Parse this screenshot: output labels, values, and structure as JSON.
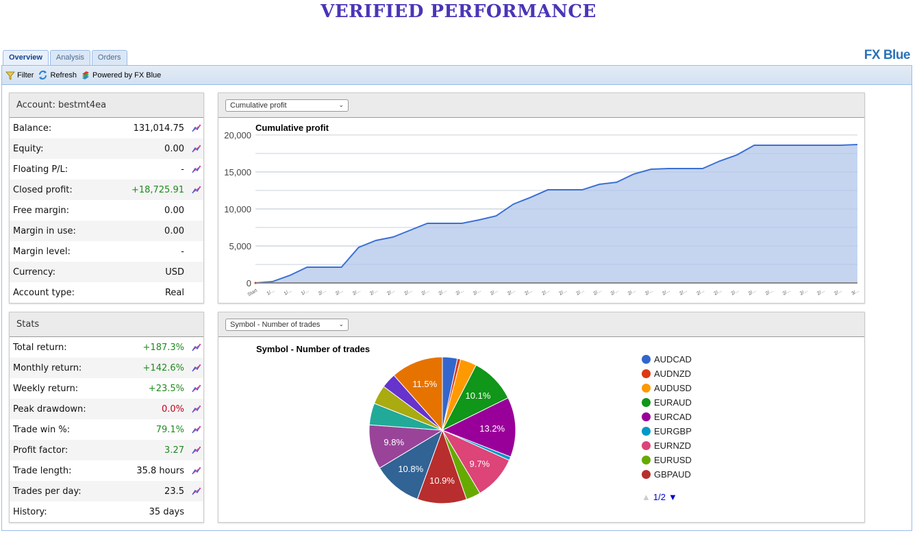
{
  "page_title": "VERIFIED PERFORMANCE",
  "brand": "FX Blue",
  "tabs": [
    {
      "label": "Overview",
      "active": true
    },
    {
      "label": "Analysis",
      "active": false
    },
    {
      "label": "Orders",
      "active": false
    }
  ],
  "toolbar": {
    "filter": "Filter",
    "refresh": "Refresh",
    "powered": "Powered by FX Blue"
  },
  "account": {
    "title": "Account: bestmt4ea",
    "rows": [
      {
        "label": "Balance:",
        "value": "131,014.75",
        "color": "",
        "icon": true
      },
      {
        "label": "Equity:",
        "value": "0.00",
        "color": "",
        "icon": true
      },
      {
        "label": "Floating P/L:",
        "value": "-",
        "color": "",
        "icon": true
      },
      {
        "label": "Closed profit:",
        "value": "+18,725.91",
        "color": "green",
        "icon": true
      },
      {
        "label": "Free margin:",
        "value": "0.00",
        "color": "",
        "icon": false
      },
      {
        "label": "Margin in use:",
        "value": "0.00",
        "color": "",
        "icon": false
      },
      {
        "label": "Margin level:",
        "value": "-",
        "color": "",
        "icon": false
      },
      {
        "label": "Currency:",
        "value": "USD",
        "color": "",
        "icon": false
      },
      {
        "label": "Account type:",
        "value": "Real",
        "color": "",
        "icon": false
      }
    ]
  },
  "stats": {
    "title": "Stats",
    "rows": [
      {
        "label": "Total return:",
        "value": "+187.3%",
        "color": "green",
        "icon": true
      },
      {
        "label": "Monthly return:",
        "value": "+142.6%",
        "color": "green",
        "icon": true
      },
      {
        "label": "Weekly return:",
        "value": "+23.5%",
        "color": "green",
        "icon": true
      },
      {
        "label": "Peak drawdown:",
        "value": "0.0%",
        "color": "red",
        "icon": true
      },
      {
        "label": "Trade win %:",
        "value": "79.1%",
        "color": "green",
        "icon": true
      },
      {
        "label": "Profit factor:",
        "value": "3.27",
        "color": "green",
        "icon": true
      },
      {
        "label": "Trade length:",
        "value": "35.8 hours",
        "color": "",
        "icon": true
      },
      {
        "label": "Trades per day:",
        "value": "23.5",
        "color": "",
        "icon": true
      },
      {
        "label": "History:",
        "value": "35 days",
        "color": "",
        "icon": false
      }
    ]
  },
  "chart1_select": "Cumulative profit",
  "chart2_select": "Symbol - Number of trades",
  "legend_pager": "1/2",
  "chart_data": [
    {
      "type": "area",
      "title": "Cumulative profit",
      "xlabel": "",
      "ylabel": "",
      "ylim": [
        0,
        20000
      ],
      "yticks": [
        "0",
        "5,000",
        "10,000",
        "15,000",
        "20,000"
      ],
      "grid": true,
      "x": [
        "Start",
        "1/...",
        "1/...",
        "1/...",
        "2/...",
        "2/...",
        "2/...",
        "2/...",
        "2/...",
        "2/...",
        "2/...",
        "2/...",
        "2/...",
        "2/...",
        "2/...",
        "2/...",
        "2/...",
        "2/...",
        "2/...",
        "2/...",
        "2/...",
        "2/...",
        "2/...",
        "2/...",
        "2/...",
        "2/...",
        "2/...",
        "2/...",
        "2/...",
        "2/...",
        "2/...",
        "2/...",
        "2/...",
        "2/...",
        "2/...",
        "3/..."
      ],
      "values": [
        0,
        190,
        1020,
        2130,
        2130,
        2130,
        4810,
        5740,
        6200,
        7130,
        8060,
        8060,
        8060,
        8520,
        9070,
        10650,
        11570,
        12590,
        12590,
        12590,
        13330,
        13610,
        14720,
        15370,
        15460,
        15460,
        15460,
        16480,
        17310,
        18610,
        18610,
        18610,
        18610,
        18610,
        18610,
        18700
      ],
      "color": "#3b6fd4",
      "fill": "#c2d3ef"
    },
    {
      "type": "pie",
      "title": "Symbol - Number of trades",
      "legend_position": "right",
      "slices": [
        {
          "label": "AUDCAD",
          "value": 3.3,
          "color": "#3366cc",
          "show_label": false
        },
        {
          "label": "AUDNZD",
          "value": 0.7,
          "color": "#dc3912",
          "show_label": false
        },
        {
          "label": "AUDUSD",
          "value": 3.6,
          "color": "#ff9900",
          "show_label": false
        },
        {
          "label": "EURAUD",
          "value": 10.1,
          "color": "#109618",
          "show_label": true
        },
        {
          "label": "EURCAD",
          "value": 13.2,
          "color": "#990099",
          "show_label": true
        },
        {
          "label": "EURGBP",
          "value": 0.8,
          "color": "#0099c6",
          "show_label": false
        },
        {
          "label": "EURNZD",
          "value": 9.7,
          "color": "#dd4477",
          "show_label": true
        },
        {
          "label": "EURUSD",
          "value": 3.2,
          "color": "#66aa00",
          "show_label": false
        },
        {
          "label": "GBPAUD",
          "value": 10.9,
          "color": "#b82e2e",
          "show_label": true
        },
        {
          "label": "",
          "value": 10.8,
          "color": "#316395",
          "show_label": true
        },
        {
          "label": "",
          "value": 9.8,
          "color": "#994499",
          "show_label": true
        },
        {
          "label": "",
          "value": 4.8,
          "color": "#22aa99",
          "show_label": false
        },
        {
          "label": "",
          "value": 4.2,
          "color": "#aaaa11",
          "show_label": false
        },
        {
          "label": "",
          "value": 3.3,
          "color": "#6633cc",
          "show_label": false
        },
        {
          "label": "",
          "value": 11.5,
          "color": "#e67300",
          "show_label": true
        }
      ],
      "legend": [
        "AUDCAD",
        "AUDNZD",
        "AUDUSD",
        "EURAUD",
        "EURCAD",
        "EURGBP",
        "EURNZD",
        "EURUSD",
        "GBPAUD"
      ]
    }
  ]
}
